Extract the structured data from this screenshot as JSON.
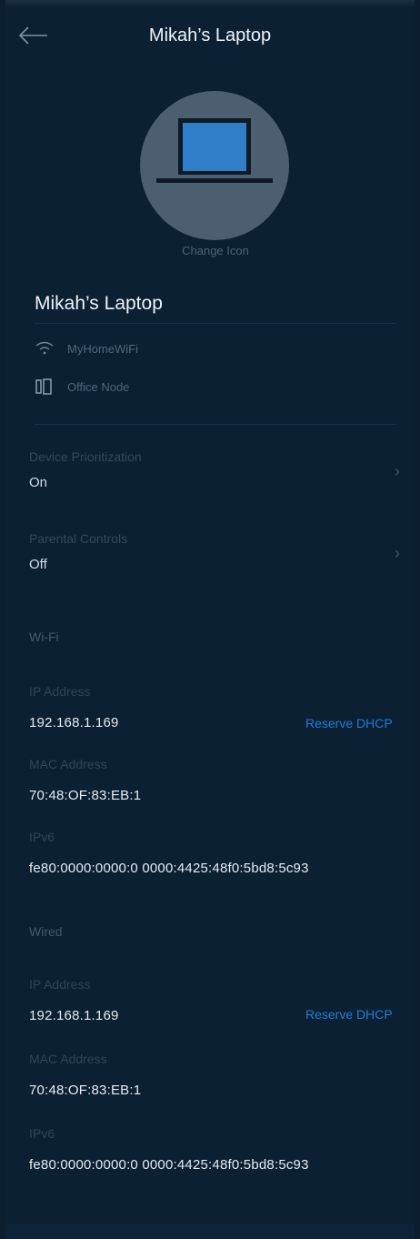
{
  "header": {
    "title": "Mikah’s Laptop",
    "back_icon": "arrow-left-icon"
  },
  "avatar": {
    "icon": "laptop-icon",
    "change_label": "Change Icon"
  },
  "device": {
    "name": "Mikah’s Laptop",
    "network": "MyHomeWiFi",
    "network_icon": "wifi-icon",
    "node": "Office Node",
    "node_icon": "node-icon"
  },
  "settings": [
    {
      "label": "Device Prioritization",
      "value": "On"
    },
    {
      "label": "Parental Controls",
      "value": "Off"
    }
  ],
  "wifi": {
    "heading": "Wi-Fi",
    "ip_label": "IP Address",
    "ip": "192.168.1.169",
    "reserve": "Reserve DHCP",
    "mac_label": "MAC Address",
    "mac": "70:48:OF:83:EB:1",
    "ipv6_label": "IPv6",
    "ipv6": "fe80:0000:0000:0 0000:4425:48f0:5bd8:5c93"
  },
  "wired": {
    "heading": "Wired",
    "ip_label": "IP Address",
    "ip": "192.168.1.169",
    "reserve": "Reserve DHCP",
    "mac_label": "MAC Address",
    "mac": "70:48:OF:83:EB:1",
    "ipv6_label": "IPv6",
    "ipv6": "fe80:0000:0000:0 0000:4425:48f0:5bd8:5c93"
  },
  "colors": {
    "background": "#0b2033",
    "accent": "#1e7fd4",
    "avatar": "#4b5f71",
    "laptop_screen": "#2f7fc8"
  }
}
